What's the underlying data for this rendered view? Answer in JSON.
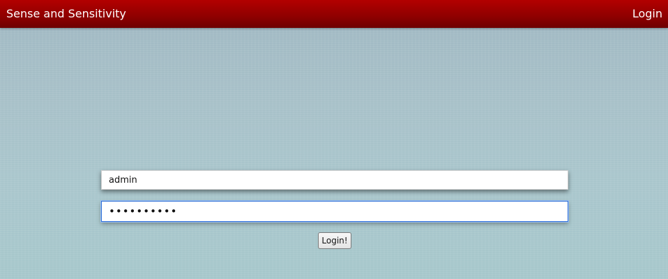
{
  "navbar": {
    "brand": "Sense and Sensitivity",
    "login_link": "Login",
    "color": "#a00000"
  },
  "login_form": {
    "username_value": "admin",
    "password_value": "••••••••••",
    "submit_label": "Login!"
  }
}
